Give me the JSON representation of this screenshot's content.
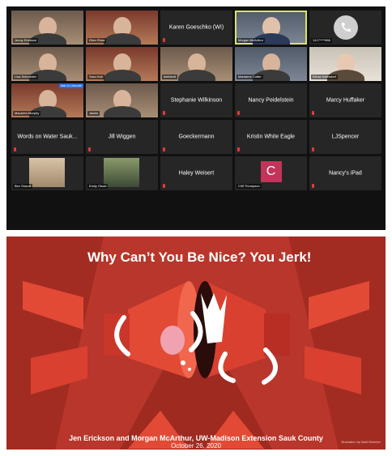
{
  "colors": {
    "zoom_bg": "#111111",
    "tile_bg": "#262626",
    "active_outline": "#d7e36a",
    "slide_bg": "#b8362b",
    "avatar_c": "#c2345a"
  },
  "zoom": {
    "tiles": [
      {
        "name": "Jenny Erickson",
        "kind": "video"
      },
      {
        "name": "Ellen Rima",
        "kind": "video"
      },
      {
        "name": "Karen Goeschko (WI)",
        "kind": "text"
      },
      {
        "name": "Morgan McArthur",
        "kind": "video",
        "active": true
      },
      {
        "name": "1417****586",
        "kind": "phone",
        "icon": "phone-icon"
      },
      {
        "name": "Lisa Schroeder",
        "kind": "video"
      },
      {
        "name": "Sara Holt",
        "kind": "video"
      },
      {
        "name": "bielhiedt",
        "kind": "video"
      },
      {
        "name": "Marianne Cotter",
        "kind": "video"
      },
      {
        "name": "Elena Hafendorf",
        "kind": "video"
      },
      {
        "name": "Maureen Murphy",
        "kind": "video",
        "badge": "Ask to Unmute"
      },
      {
        "name": "Jackie",
        "kind": "video"
      },
      {
        "name": "Stephanie Wilkinson",
        "kind": "text"
      },
      {
        "name": "Nancy Peidelstein",
        "kind": "text"
      },
      {
        "name": "Marcy Huffaker",
        "kind": "text"
      },
      {
        "name": "Words on Water Sauk...",
        "kind": "text"
      },
      {
        "name": "Jill Wiggen",
        "kind": "text"
      },
      {
        "name": "Goeckermann",
        "kind": "text"
      },
      {
        "name": "Kristin White Eagle",
        "kind": "text"
      },
      {
        "name": "LJSpencer",
        "kind": "text"
      },
      {
        "name": "Bev Strand",
        "kind": "photo"
      },
      {
        "name": "Emily Olson",
        "kind": "photo"
      },
      {
        "name": "Haley Weisert",
        "kind": "text"
      },
      {
        "name": "Cliff Thompson",
        "kind": "avatar",
        "initial": "C"
      },
      {
        "name": "Nancy's iPad",
        "kind": "text"
      }
    ],
    "maureen_badge": "Ask to Unmute"
  },
  "slide": {
    "title": "Why Can’t You Be Nice? You Jerk!",
    "authors": "Jen Erickson and Morgan McArthur, UW-Madison Extension Sauk County",
    "date": "October 26, 2020",
    "credit": "Illustration by Matt Wuerker",
    "art_icons": [
      "megaphone-icon",
      "angry-mouth-icon",
      "fist-icon",
      "tongue-icon"
    ]
  }
}
